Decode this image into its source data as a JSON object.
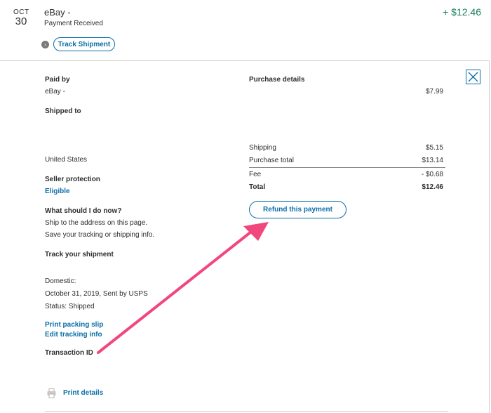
{
  "transaction": {
    "date_month": "OCT",
    "date_day": "30",
    "merchant": "eBay -",
    "status": "Payment Received",
    "amount": "+ $12.46",
    "track_button": "Track Shipment"
  },
  "details": {
    "paid_by_label": "Paid by",
    "paid_by_value": "eBay -",
    "shipped_to_label": "Shipped to",
    "country": "United States",
    "seller_protection_label": "Seller protection",
    "seller_protection_value": "Eligible",
    "what_now_label": "What should I do now?",
    "what_now_line1": "Ship to the address on this page.",
    "what_now_line2": "Save your tracking or shipping info.",
    "track_label": "Track your shipment",
    "domestic_label": "Domestic:",
    "ship_date": "October 31, 2019, Sent by USPS",
    "ship_status": "Status: Shipped",
    "print_slip": "Print packing slip",
    "edit_tracking": "Edit tracking info",
    "transaction_id_label": "Transaction ID",
    "print_details": "Print details"
  },
  "purchase": {
    "title": "Purchase details",
    "item_price": "$7.99",
    "shipping_label": "Shipping",
    "shipping_value": "$5.15",
    "purchase_total_label": "Purchase total",
    "purchase_total_value": "$13.14",
    "fee_label": "Fee",
    "fee_value": "- $0.68",
    "total_label": "Total",
    "total_value": "$12.46",
    "refund_button": "Refund this payment"
  },
  "colors": {
    "link_blue": "#0b6ea8",
    "positive_green": "#1a7f5a",
    "annotation_arrow": "#f2477e"
  },
  "icons": {
    "close": "close-x-icon",
    "expand": "chevron-right-icon",
    "print": "printer-icon"
  }
}
